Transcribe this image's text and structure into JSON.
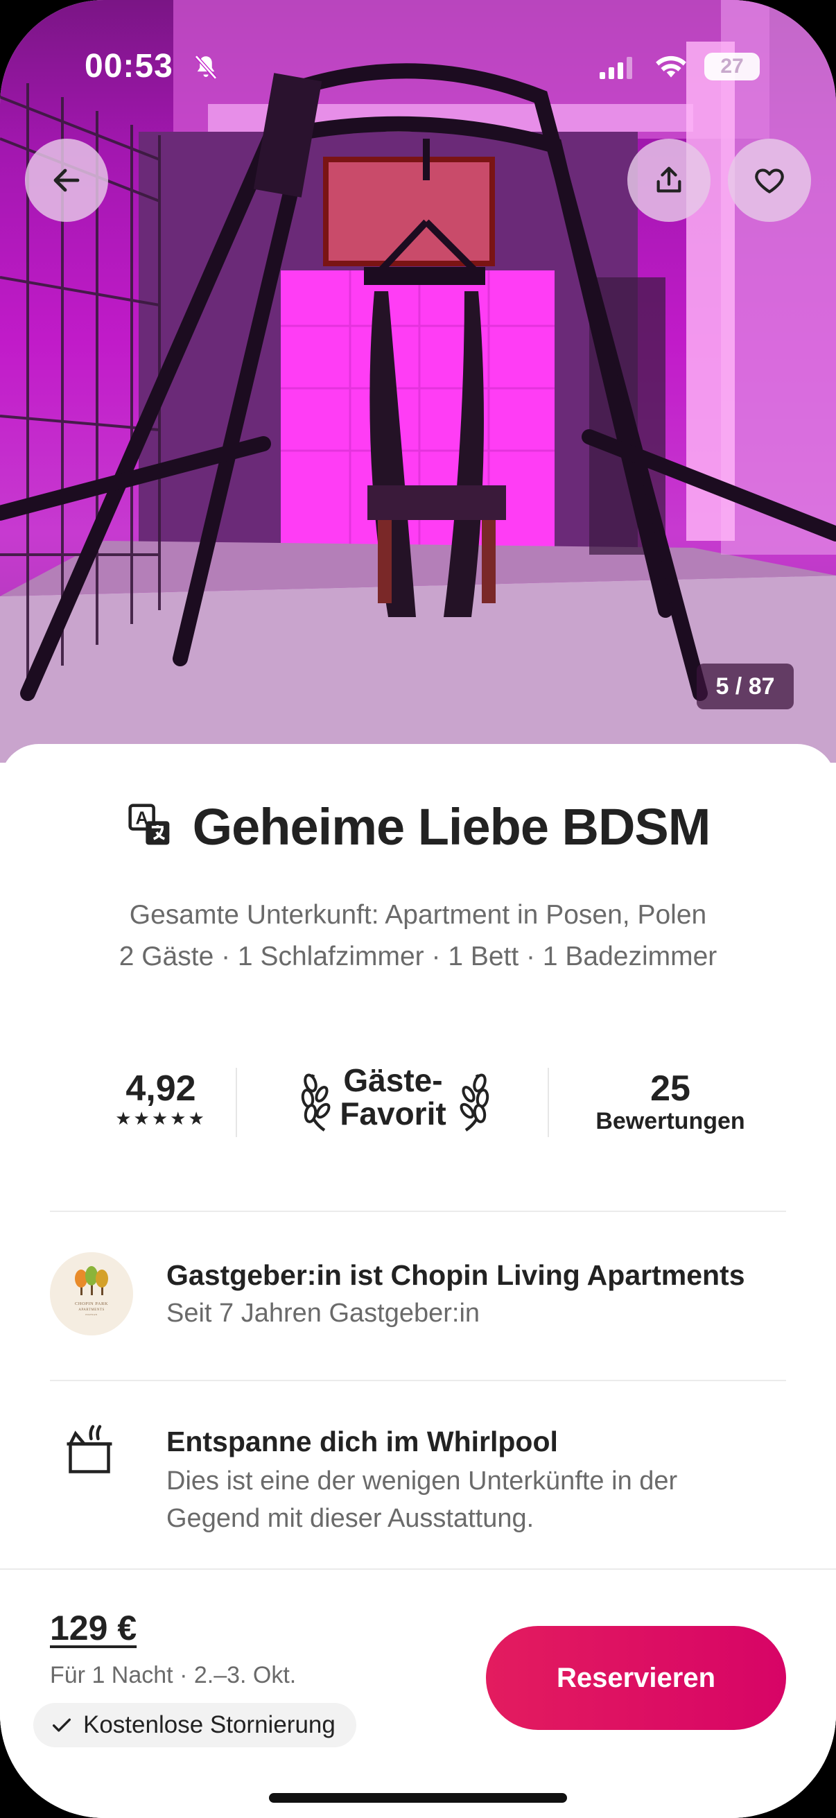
{
  "status_bar": {
    "time": "00:53",
    "battery": "27"
  },
  "gallery": {
    "counter": "5 / 87"
  },
  "listing": {
    "title": "Geheime Liebe BDSM",
    "subtitle_line1": "Gesamte Unterkunft: Apartment in Posen, Polen",
    "subtitle_line2": "2 Gäste · 1 Schlafzimmer · 1 Bett · 1 Badezimmer"
  },
  "stats": {
    "rating": "4,92",
    "stars": "★★★★★",
    "favorite_line1": "Gäste-",
    "favorite_line2": "Favorit",
    "reviews_count": "25",
    "reviews_label": "Bewertungen"
  },
  "host": {
    "title": "Gastgeber:in ist Chopin Living Apartments",
    "since": "Seit 7 Jahren Gastgeber:in",
    "logo_text": "CHOPIN PARK APARTMENTS POZNAN"
  },
  "feature": {
    "title": "Entspanne dich im Whirlpool",
    "description": "Dies ist eine der wenigen Unterkünfte in der Gegend mit dieser Ausstattung."
  },
  "booking": {
    "price": "129 €",
    "price_sub": "Für 1 Nacht · 2.–3. Okt.",
    "cancellation": "Kostenlose Stornierung",
    "reserve_label": "Reservieren"
  },
  "colors": {
    "brand": "#e31c5f",
    "hero_tint": "#c11bc9"
  }
}
